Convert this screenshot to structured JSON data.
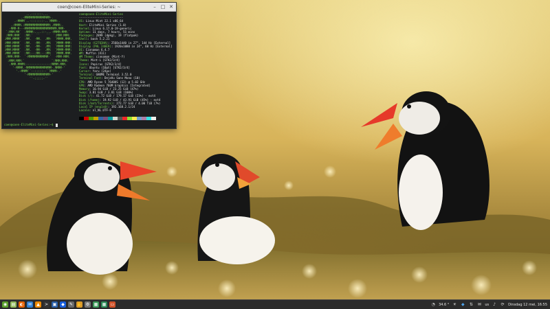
{
  "terminal": {
    "title": "coen@coen-EliteMini-Series: ~",
    "ascii_logo": "             ...-:::::-...\n          .-MMMMMMMMMMMMMMM-.\n      .-MMMM`..-:::::::-..`MMMM-.\n    .:MMMM.:MMMMMMMMMMMMMMM:.MMMM:.\n   -MMM-M---MMMMMMMMMMMMMMMMMMM.MMM-\n `:MMM:MM`  :MMMM:....::-...-MMMM:MMM:`\n :MMM:MMM`  :MM:`  ``    ``  `:MMM:MMM:\n.MMM.MMMM`  :MM.  -MM.  .MM-  `MMMM.MMM.\n:MMM:MMMM`  :MM.  -MM-  .MM:  `MMMM-MMM:\n:MMM:MMMM`  :MM.  -MM-  .MM:  `MMMM:MMM:\n:MMM:MMMM`  :MM.  -MM-  .MM:  `MMMM-MMM:\n.MMM.MMMM`  :MM:--:MM:--:MM:  `MMMM.MMM.\n :MMM:MMM-  `-MMMMMMMMMMMM-`  -MMM-MMM:\n  :MMM:MMM:`                `:MMM:MMM:\n   .MMM.MMMM:--------------:MMMM.MMM.\n     '-MMMM.-MMMMMMMMMMMMMMM-.MMMM-'\n       '.-MMMM``--:::::--``MMMM-.'\n            '-MMMMMMMMMMMMM-'\n               ``-:::::-``",
    "user_host": "coen@coen-EliteMini-Series",
    "separator": "--------------------------",
    "info": [
      {
        "label": "OS",
        "value": "Linux Mint 22.1 x86_64"
      },
      {
        "label": "Host",
        "value": "EliteMini Series (1.0)"
      },
      {
        "label": "Kernel",
        "value": "Linux 6.17.0-19-generic"
      },
      {
        "label": "Uptime",
        "value": "11 days, 7 hours, 51 mins"
      },
      {
        "label": "Packages",
        "value": "2899 (dpkg), 19 (flatpak)"
      },
      {
        "label": "Shell",
        "value": "bash 5.2.21"
      },
      {
        "label": "Display (G27Q3HA)",
        "value": "2560x1440 in 27\", 144 Hz [External]"
      },
      {
        "label": "Display (PHL 240E9)",
        "value": "1920x1080 in 24\", 60 Hz [External]"
      },
      {
        "label": "DE",
        "value": "Cinnamon 6.4.7"
      },
      {
        "label": "WM",
        "value": "Muffin (X11)"
      },
      {
        "label": "WM Theme",
        "value": "cinnamon (Mint-Y)"
      },
      {
        "label": "Theme",
        "value": "Mint-L [GTK2/3/4]"
      },
      {
        "label": "Icons",
        "value": "Papirus [GTK2/3/4]"
      },
      {
        "label": "Font",
        "value": "Ubuntu (10pt) [GTK2/3/4]"
      },
      {
        "label": "Cursor",
        "value": "Yaru (24px)"
      },
      {
        "label": "Terminal",
        "value": "GNOME Terminal 3.52.0"
      },
      {
        "label": "Terminal Font",
        "value": "DejaVu Sans Mono (10)"
      },
      {
        "label": "CPU",
        "value": "AMD Ryzen 5 7640HS (12) @ 5.02 GHz"
      },
      {
        "label": "GPU",
        "value": "AMD Radeon 760M Graphics [Integrated]"
      },
      {
        "label": "Memory",
        "value": "10.94 GiB / 23.25 GiB (47%)"
      },
      {
        "label": "Swap",
        "value": "3.81 GiB / 3.81 GiB (100%)"
      },
      {
        "label": "Disk (/)",
        "value": "41.72 GiB / 179.17 GiB (23%) - ext4"
      },
      {
        "label": "Disk (/home)",
        "value": "19.92 GiB / 43.91 GiB (45%) - ext4"
      },
      {
        "label": "Disk (/mnt/Torrents)",
        "value": "272.77 GiB / 4.00 TiB (7%)"
      },
      {
        "label": "Local IP (enp1s0)",
        "value": "192.168.2.1/24"
      },
      {
        "label": "Locale",
        "value": "nl_NL.UTF-8"
      }
    ],
    "palette_colors": [
      "#000000",
      "#cc0000",
      "#4e9a06",
      "#c4a000",
      "#3465a4",
      "#75507b",
      "#06989a",
      "#d3d7cf",
      "#555753",
      "#ef2929",
      "#8ae234",
      "#fce94f",
      "#729fcf",
      "#ad7fa8",
      "#34e2e2",
      "#eeeeec"
    ],
    "prompt": "coen@coen-EliteMini-Series:~$ "
  },
  "taskbar": {
    "launcher_icons": [
      "mint-menu-icon",
      "files-icon",
      "firefox-icon",
      "thunderbird-icon",
      "vlc-icon",
      "terminal-icon",
      "virtualbox-icon",
      "bitwarden-icon",
      "text-editor-icon",
      "hand-icon",
      "settings-icon",
      "image-viewer-icon",
      "spreadsheet-icon",
      "presentation-icon"
    ],
    "temperature": "34.6 °",
    "keyboard_layout": "us",
    "clock": "Dinsdag 12 mei, 16:55"
  },
  "wallpaper": {
    "subject": "puffins"
  }
}
